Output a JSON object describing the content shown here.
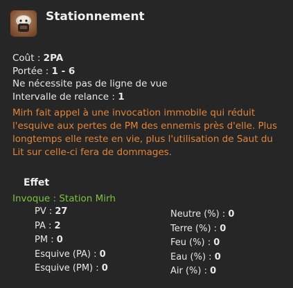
{
  "header": {
    "title": "Stationnement",
    "icon": "summon-creature-icon"
  },
  "stats": [
    {
      "label": "Coût : ",
      "value": "2PA"
    },
    {
      "label": "Portée : ",
      "value": "1 - 6"
    },
    {
      "label": "Ne nécessite pas de ligne de vue",
      "value": ""
    },
    {
      "label": "Intervalle de relance : ",
      "value": "1"
    }
  ],
  "description": "Mirh fait appel à une invocation immobile qui réduit l'esquive aux pertes de PM des ennemis près d'elle. Plus longtemps elle reste en vie, plus l'utilisation de Saut du Lit sur celle-ci fera de dommages.",
  "effect": {
    "title": "Effet",
    "invoque": "Invoque : Station Mirh",
    "left_stats": [
      {
        "label": "PV : ",
        "value": "27"
      },
      {
        "label": "PA : ",
        "value": "2"
      },
      {
        "label": "PM : ",
        "value": "0"
      },
      {
        "label": "Esquive (PA) : ",
        "value": "0"
      },
      {
        "label": "Esquive (PM) : ",
        "value": "0"
      }
    ],
    "right_stats": [
      {
        "label": "Neutre (%) : ",
        "value": "0"
      },
      {
        "label": "Terre (%) : ",
        "value": "0"
      },
      {
        "label": "Feu (%) : ",
        "value": "0"
      },
      {
        "label": "Eau (%) : ",
        "value": "0"
      },
      {
        "label": "Air (%) : ",
        "value": "0"
      }
    ]
  },
  "colors": {
    "background": "#262626",
    "description": "#e0853a",
    "invoque": "#7cc341"
  }
}
